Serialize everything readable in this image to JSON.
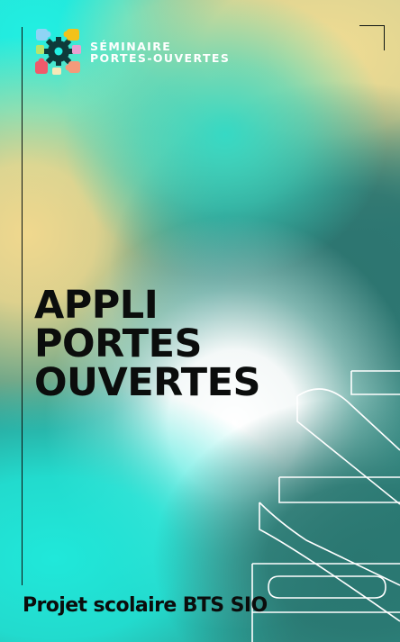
{
  "header": {
    "brand_line1": "SÉMINAIRE",
    "brand_line2": "PORTES-OUVERTES",
    "logo_icon": "gear-puzzle-logo-icon"
  },
  "main": {
    "title_line1": "APPLI",
    "title_line2": "PORTES",
    "title_line3": "OUVERTES",
    "year_decoration": "2022"
  },
  "footer": {
    "subtitle": "Projet scolaire BTS SIO"
  },
  "colors": {
    "cyan": "#22efe2",
    "sand": "#f1dc93",
    "teal_dark": "#2d7570",
    "text_dark": "#0b0d0c",
    "text_light": "#ffffff"
  }
}
